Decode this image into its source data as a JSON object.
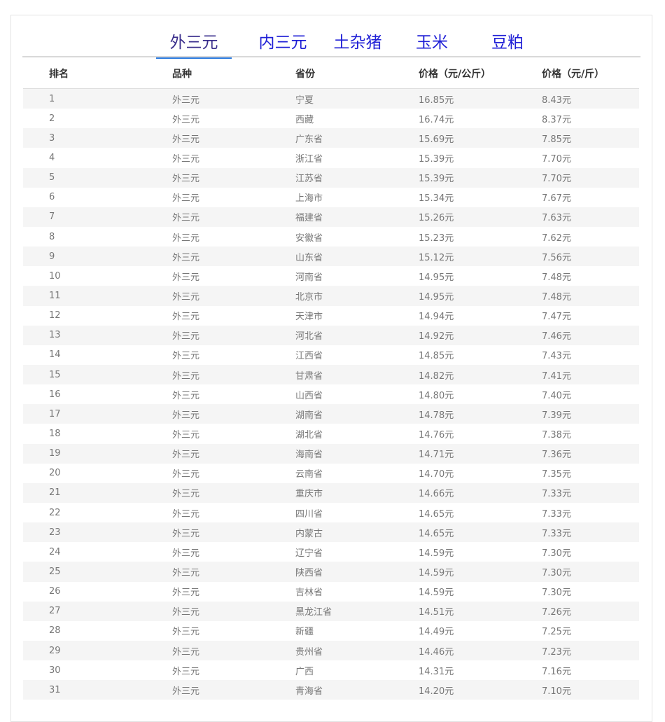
{
  "tabs": [
    {
      "label": "外三元",
      "active": true
    },
    {
      "label": "内三元",
      "active": false
    },
    {
      "label": "土杂猪",
      "active": false
    },
    {
      "label": "玉米",
      "active": false
    },
    {
      "label": "豆粕",
      "active": false
    }
  ],
  "table": {
    "headers": [
      "排名",
      "品种",
      "省份",
      "价格（元/公斤）",
      "价格（元/斤）"
    ],
    "rows": [
      [
        "1",
        "外三元",
        "宁夏",
        "16.85元",
        "8.43元"
      ],
      [
        "2",
        "外三元",
        "西藏",
        "16.74元",
        "8.37元"
      ],
      [
        "3",
        "外三元",
        "广东省",
        "15.69元",
        "7.85元"
      ],
      [
        "4",
        "外三元",
        "浙江省",
        "15.39元",
        "7.70元"
      ],
      [
        "5",
        "外三元",
        "江苏省",
        "15.39元",
        "7.70元"
      ],
      [
        "6",
        "外三元",
        "上海市",
        "15.34元",
        "7.67元"
      ],
      [
        "7",
        "外三元",
        "福建省",
        "15.26元",
        "7.63元"
      ],
      [
        "8",
        "外三元",
        "安徽省",
        "15.23元",
        "7.62元"
      ],
      [
        "9",
        "外三元",
        "山东省",
        "15.12元",
        "7.56元"
      ],
      [
        "10",
        "外三元",
        "河南省",
        "14.95元",
        "7.48元"
      ],
      [
        "11",
        "外三元",
        "北京市",
        "14.95元",
        "7.48元"
      ],
      [
        "12",
        "外三元",
        "天津市",
        "14.94元",
        "7.47元"
      ],
      [
        "13",
        "外三元",
        "河北省",
        "14.92元",
        "7.46元"
      ],
      [
        "14",
        "外三元",
        "江西省",
        "14.85元",
        "7.43元"
      ],
      [
        "15",
        "外三元",
        "甘肃省",
        "14.82元",
        "7.41元"
      ],
      [
        "16",
        "外三元",
        "山西省",
        "14.80元",
        "7.40元"
      ],
      [
        "17",
        "外三元",
        "湖南省",
        "14.78元",
        "7.39元"
      ],
      [
        "18",
        "外三元",
        "湖北省",
        "14.76元",
        "7.38元"
      ],
      [
        "19",
        "外三元",
        "海南省",
        "14.71元",
        "7.36元"
      ],
      [
        "20",
        "外三元",
        "云南省",
        "14.70元",
        "7.35元"
      ],
      [
        "21",
        "外三元",
        "重庆市",
        "14.66元",
        "7.33元"
      ],
      [
        "22",
        "外三元",
        "四川省",
        "14.65元",
        "7.33元"
      ],
      [
        "23",
        "外三元",
        "内蒙古",
        "14.65元",
        "7.33元"
      ],
      [
        "24",
        "外三元",
        "辽宁省",
        "14.59元",
        "7.30元"
      ],
      [
        "25",
        "外三元",
        "陕西省",
        "14.59元",
        "7.30元"
      ],
      [
        "26",
        "外三元",
        "吉林省",
        "14.59元",
        "7.30元"
      ],
      [
        "27",
        "外三元",
        "黑龙江省",
        "14.51元",
        "7.26元"
      ],
      [
        "28",
        "外三元",
        "新疆",
        "14.49元",
        "7.25元"
      ],
      [
        "29",
        "外三元",
        "贵州省",
        "14.46元",
        "7.23元"
      ],
      [
        "30",
        "外三元",
        "广西",
        "14.31元",
        "7.16元"
      ],
      [
        "31",
        "外三元",
        "青海省",
        "14.20元",
        "7.10元"
      ]
    ]
  },
  "colors": {
    "tab_text": "#1f1fd6",
    "tab_active_text": "#3a2e8c",
    "tab_active_underline": "#2b7be0",
    "row_stripe": "#f5f5f5",
    "cell_text": "#777777",
    "header_text": "#333333"
  }
}
